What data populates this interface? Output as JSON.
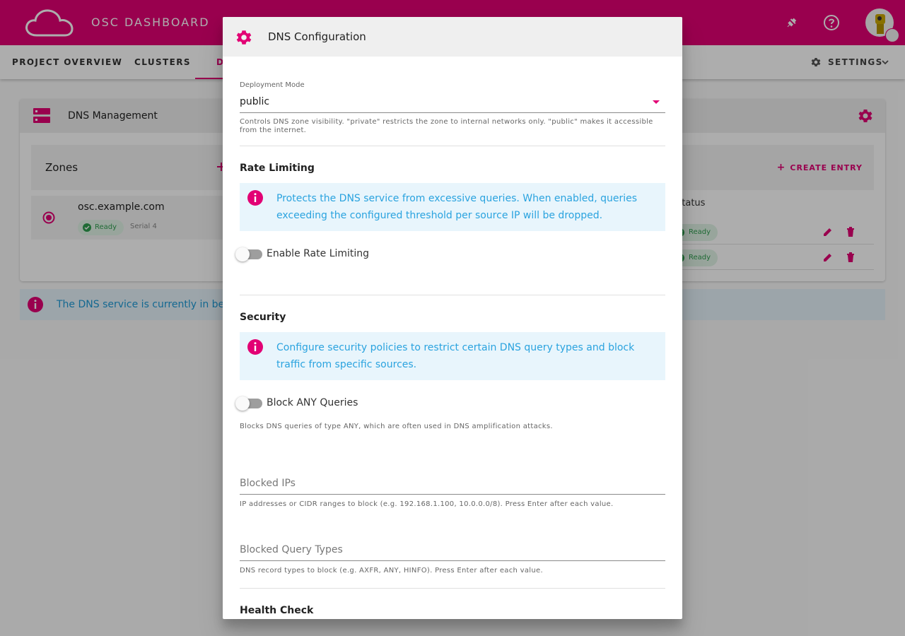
{
  "app": {
    "title": "OSC DASHBOARD"
  },
  "tabs": [
    {
      "label": "PROJECT OVERVIEW"
    },
    {
      "label": "CLUSTERS"
    },
    {
      "label": "D"
    }
  ],
  "settings_tab": {
    "label": "SETTINGS"
  },
  "card": {
    "title": "DNS Management",
    "zones_title": "Zones",
    "zone": {
      "name": "osc.example.com",
      "status": "Ready",
      "serial": "Serial 4"
    },
    "create_entry": "CREATE ENTRY",
    "status_col": "Status",
    "rows": [
      {
        "status": "Ready"
      },
      {
        "status": "Ready"
      }
    ]
  },
  "beta_banner": "The DNS service is currently in beta. W",
  "dialog": {
    "title": "DNS Configuration",
    "deployment_mode": {
      "label": "Deployment Mode",
      "value": "public",
      "hint": "Controls DNS zone visibility. \"private\" restricts the zone to internal networks only. \"public\" makes it accessible from the internet."
    },
    "rate_limiting": {
      "title": "Rate Limiting",
      "info": "Protects the DNS service from excessive queries. When enabled, queries exceeding the configured threshold per source IP will be dropped.",
      "toggle_label": "Enable Rate Limiting",
      "enabled": false
    },
    "security": {
      "title": "Security",
      "info": "Configure security policies to restrict certain DNS query types and block traffic from specific sources.",
      "block_any_label": "Block ANY Queries",
      "block_any_enabled": false,
      "block_any_hint": "Blocks DNS queries of type ANY, which are often used in DNS amplification attacks.",
      "blocked_ips_label": "Blocked IPs",
      "blocked_ips_hint": "IP addresses or CIDR ranges to block (e.g. 192.168.1.100, 10.0.0.0/8). Press Enter after each value.",
      "blocked_types_label": "Blocked Query Types",
      "blocked_types_hint": "DNS record types to block (e.g. AXFR, ANY, HINFO). Press Enter after each value."
    },
    "health_check": {
      "title": "Health Check"
    }
  },
  "colors": {
    "brand": "#e20074",
    "info": "#2aa3df",
    "success": "#2e9e4f"
  },
  "icons": [
    "cloud-logo-icon",
    "plug-icon",
    "help-icon",
    "avatar",
    "gear-icon",
    "chevron-down-icon",
    "dns-server-icon",
    "add-icon",
    "radio-checked-icon",
    "check-circle-icon",
    "edit-icon",
    "delete-icon",
    "info-icon",
    "dropdown-arrow-icon"
  ]
}
